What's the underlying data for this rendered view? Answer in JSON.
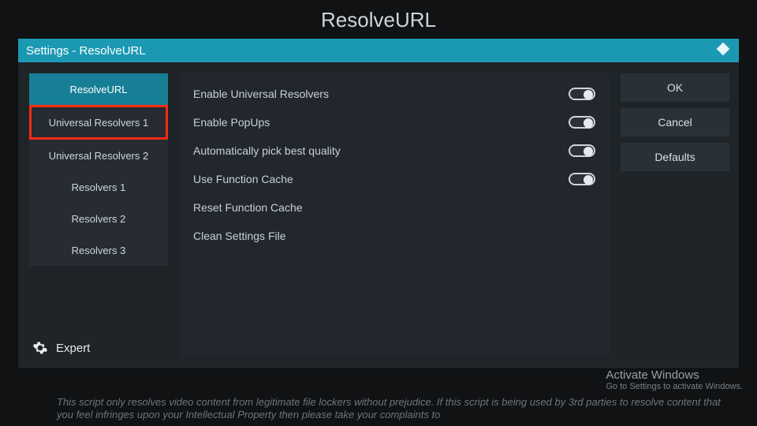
{
  "app_title": "ResolveURL",
  "dialog_title": "Settings - ResolveURL",
  "sidebar": {
    "items": [
      {
        "label": "ResolveURL"
      },
      {
        "label": "Universal Resolvers 1"
      },
      {
        "label": "Universal Resolvers 2"
      },
      {
        "label": "Resolvers 1"
      },
      {
        "label": "Resolvers 2"
      },
      {
        "label": "Resolvers 3"
      }
    ],
    "level_label": "Expert"
  },
  "settings": [
    {
      "label": "Enable Universal Resolvers",
      "toggle": true
    },
    {
      "label": "Enable PopUps",
      "toggle": true
    },
    {
      "label": "Automatically pick best quality",
      "toggle": true
    },
    {
      "label": "Use Function Cache",
      "toggle": true
    },
    {
      "label": "Reset Function Cache",
      "toggle": null
    },
    {
      "label": "Clean Settings File",
      "toggle": null
    }
  ],
  "actions": {
    "ok": "OK",
    "cancel": "Cancel",
    "defaults": "Defaults"
  },
  "watermark": {
    "line1": "Activate Windows",
    "line2": "Go to Settings to activate Windows."
  },
  "footer": "This script only resolves video content from legitimate file lockers without prejudice. If this script is being used by 3rd parties to resolve content that you feel infringes upon your Intellectual Property then please take your complaints to"
}
